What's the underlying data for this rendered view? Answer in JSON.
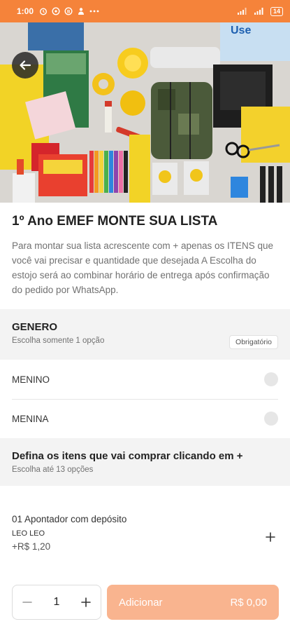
{
  "status_bar": {
    "time": "1:00",
    "battery": "14"
  },
  "product": {
    "title": "1º Ano EMEF MONTE SUA LISTA",
    "description": "Para montar sua lista acrescente com + apenas os ITENS que você vai precisar e quantidade que desejada A Escolha do estojo será ao combinar horário de entrega após confirmação do pedido por WhatsApp."
  },
  "genero": {
    "title": "GENERO",
    "subtitle": "Escolha somente 1 opção",
    "badge": "Obrigatório",
    "options": [
      {
        "label": "MENINO"
      },
      {
        "label": "MENINA"
      }
    ]
  },
  "itens": {
    "title": "Defina os itens que vai comprar clicando em +",
    "subtitle": "Escolha até 13 opções"
  },
  "item": {
    "name": "01 Apontador com depósito",
    "brand": "LEO LEO",
    "price": "+R$ 1,20"
  },
  "footer": {
    "quantity": "1",
    "add_label": "Adicionar",
    "total": "R$ 0,00"
  },
  "colors": {
    "accent": "#f5833a",
    "add_button": "#f9b48f"
  },
  "icons": [
    "back-arrow-icon",
    "plus-icon",
    "minus-icon"
  ]
}
